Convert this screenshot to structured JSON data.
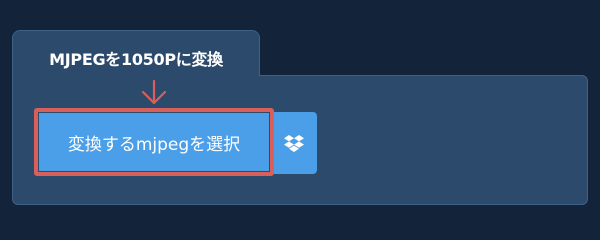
{
  "panel": {
    "title": "MJPEGを1050Pに変換"
  },
  "upload": {
    "select_label": "変換するmjpegを選択",
    "dropbox_icon": "dropbox-icon"
  },
  "colors": {
    "background": "#13233a",
    "panel": "#2c4a6b",
    "button": "#4a9fe8",
    "highlight": "#d9605a"
  }
}
